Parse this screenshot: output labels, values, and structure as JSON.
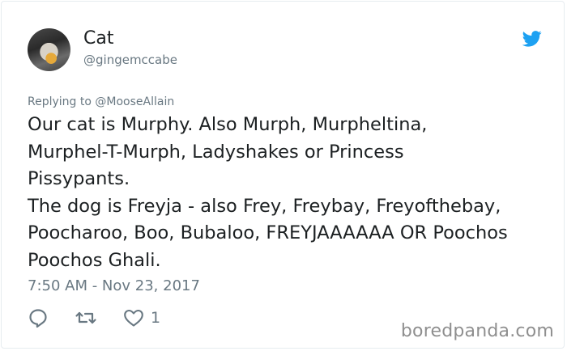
{
  "tweet": {
    "display_name": "Cat",
    "handle": "@gingemccabe",
    "reply_to_prefix": "Replying to",
    "reply_to_handle": "@MooseAllain",
    "text": "Our cat is Murphy. Also Murph, Murpheltina,\nMurphel-T-Murph, Ladyshakes or Princess\nPissypants.\nThe dog is Freyja - also Frey, Freybay, Freyofthebay,\nPoocharoo, Boo, Bubaloo, FREYJAAAAAA OR Poochos\nPoochos Ghali.",
    "timestamp": "7:50 AM - Nov 23, 2017",
    "like_count": "1"
  },
  "icons": {
    "brand": "twitter-bird-icon",
    "reply": "reply-icon",
    "retweet": "retweet-icon",
    "like": "heart-icon"
  },
  "colors": {
    "twitter_blue": "#1da1f2",
    "text_primary": "#1c2022",
    "text_secondary": "#697882",
    "watermark": "#8f8f8f"
  },
  "watermark": "boredpanda.com"
}
